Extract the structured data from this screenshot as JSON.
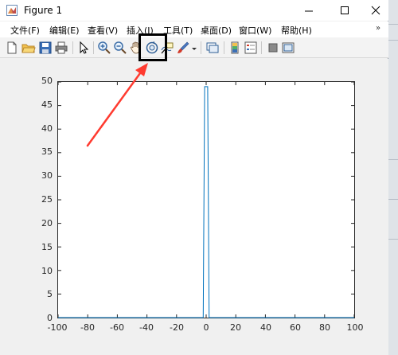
{
  "window": {
    "title": "Figure 1"
  },
  "menu": {
    "items": [
      "文件(F)",
      "编辑(E)",
      "查看(V)",
      "插入(I)",
      "工具(T)",
      "桌面(D)",
      "窗口(W)",
      "帮助(H)"
    ],
    "overflow_arrow": "»"
  },
  "toolbar": {
    "icons": [
      "new-figure-icon",
      "open-icon",
      "save-icon",
      "print-icon",
      "pointer-icon",
      "zoom-in-icon",
      "zoom-out-icon",
      "pan-icon",
      "rotate-3d-icon",
      "data-cursor-icon",
      "brush-icon",
      "link-plot-icon",
      "colorbar-icon",
      "legend-icon",
      "hide-plot-tools-icon",
      "show-plot-tools-icon"
    ],
    "highlighted": "rotate-3d-icon"
  },
  "annotation": {
    "color": "#ff3b30",
    "box_color": "#000000"
  },
  "chart_data": {
    "type": "line",
    "x": [
      -100,
      -3,
      -2,
      -1,
      0,
      1,
      2,
      3,
      100
    ],
    "series": [
      {
        "values": [
          0,
          0,
          0,
          49,
          49,
          49,
          0,
          0,
          0
        ],
        "color": "#0072bd"
      }
    ],
    "xlim": [
      -100,
      100
    ],
    "ylim": [
      0,
      50
    ],
    "xticks": [
      "-100",
      "-80",
      "-60",
      "-40",
      "-20",
      "0",
      "20",
      "40",
      "60",
      "80",
      "100"
    ],
    "yticks": [
      "0",
      "5",
      "10",
      "15",
      "20",
      "25",
      "30",
      "35",
      "40",
      "45",
      "50"
    ],
    "title": "",
    "xlabel": "",
    "ylabel": "",
    "grid": false
  }
}
